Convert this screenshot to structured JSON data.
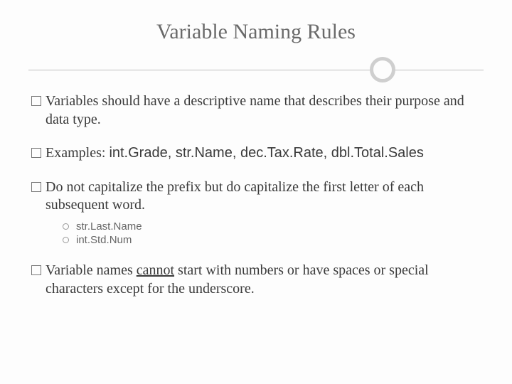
{
  "title": "Variable Naming Rules",
  "bullets": {
    "b1": "Variables should have a descriptive name that describes their purpose and data type.",
    "b2_prefix": "Examples: ",
    "b2_rest": "int.Grade, str.Name, dec.Tax.Rate, dbl.Total.Sales",
    "b3": "Do not capitalize the prefix but do capitalize the first letter of each subsequent word.",
    "b4_a": "Variable names ",
    "b4_cannot": "cannot",
    "b4_b": " start with numbers or have spaces or special characters except for the underscore."
  },
  "sub": {
    "s1": "str.Last.Name",
    "s2": "int.Std.Num"
  }
}
